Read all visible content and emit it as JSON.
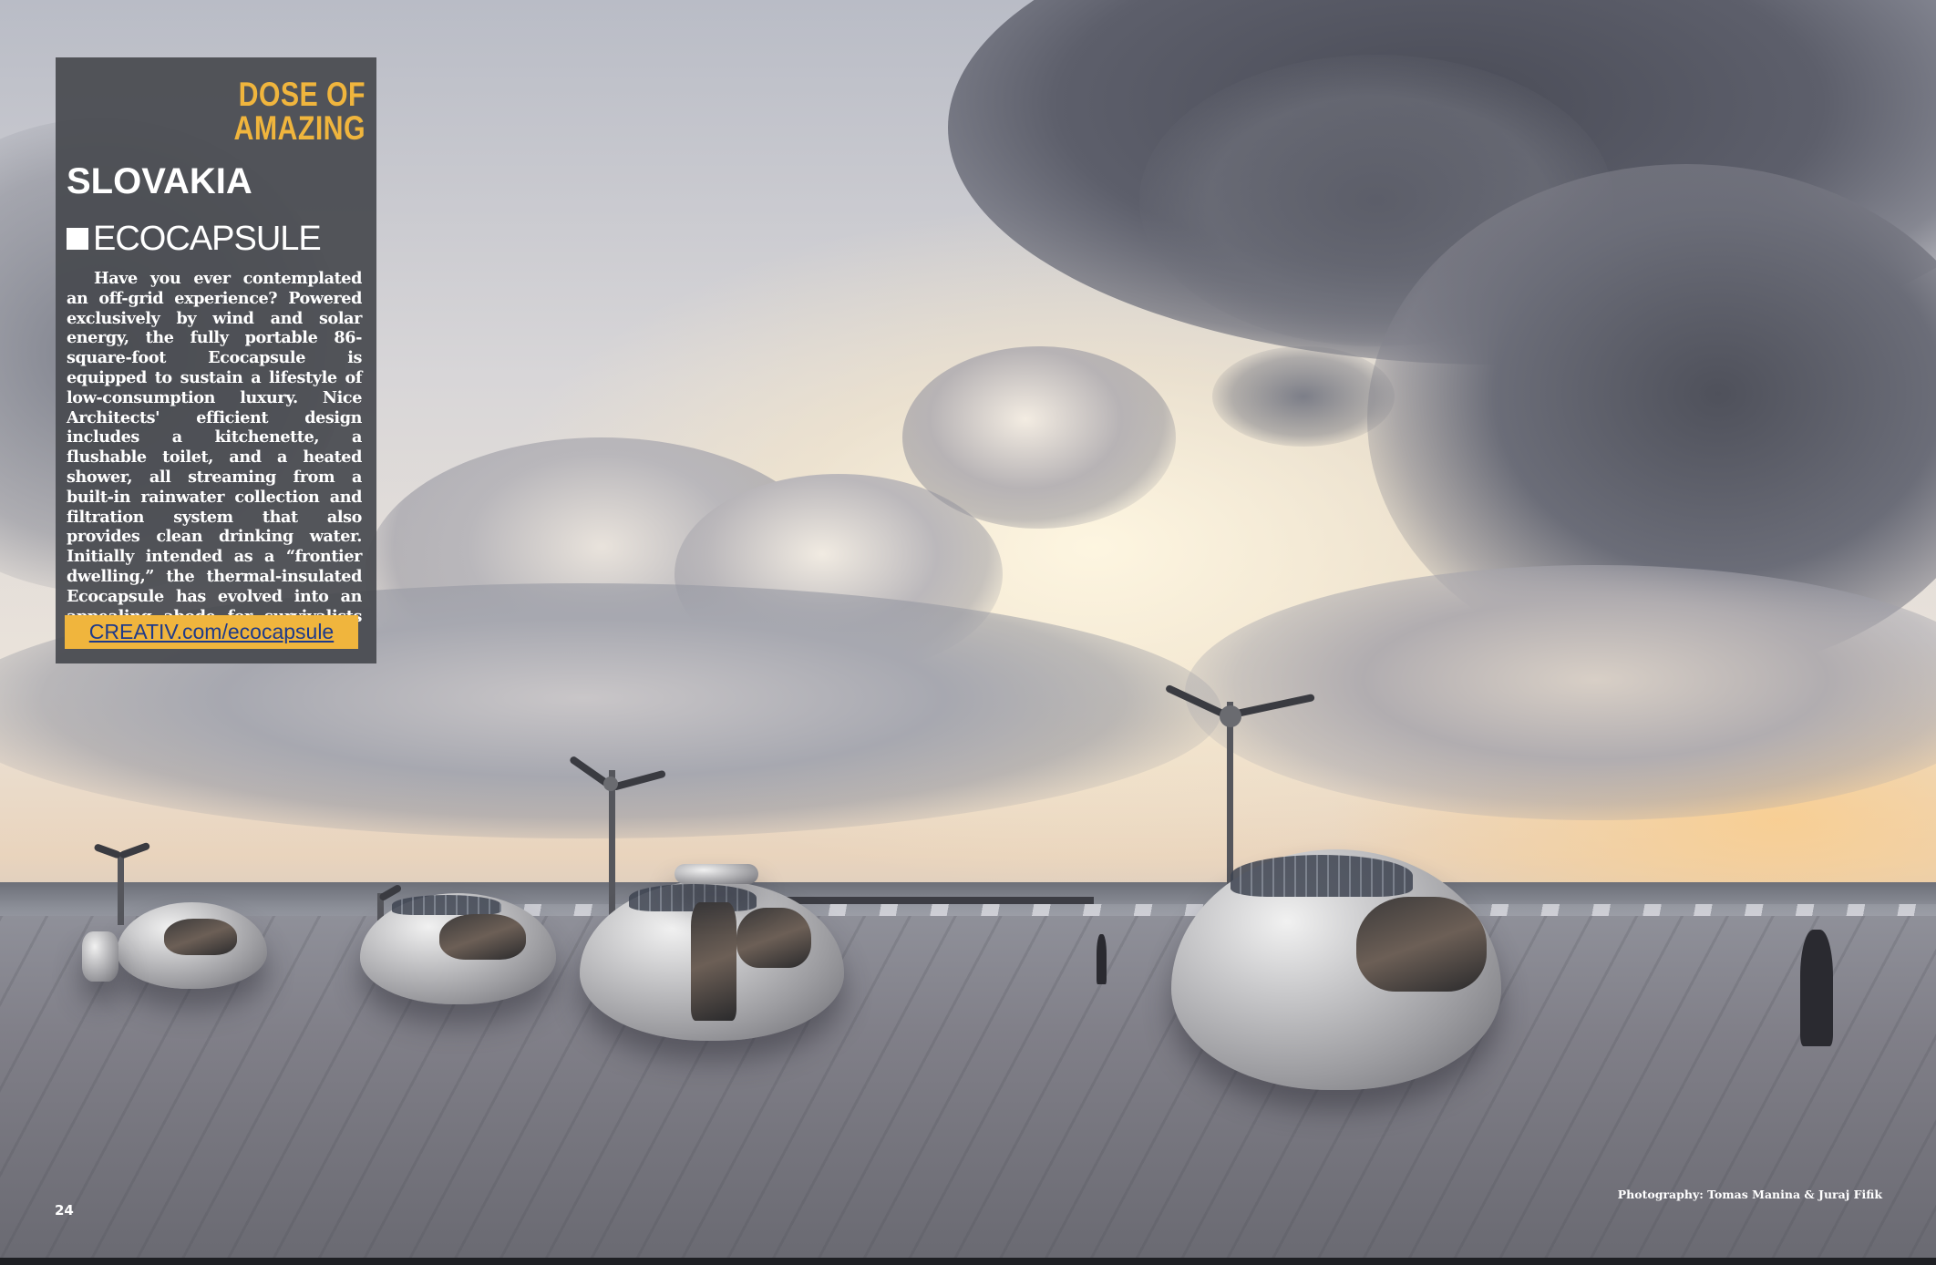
{
  "panel": {
    "kicker": "DOSE OF AMAZING",
    "country": "SLOVAKIA",
    "title": "ECOCAPSULE",
    "body": "Have you ever contemplated an off-grid experience? Powered exclusively by wind and solar energy, the fully portable 86-square-foot Ecocapsule is equipped to sustain a lifestyle of low-consumption luxury. Nice Architects' efficient design includes a kitchenette, a flushable toilet, and a heated shower, all streaming from a built-in rainwater collection and filtration system that also provides clean drinking water. Initially intended as a “frontier dwelling,” the thermal-insulated Ecocapsule has evolved into an appealing abode for survivalists and urbanists alike.",
    "link": "CREATIV.com/ecocapsule"
  },
  "footer": {
    "page_number": "24",
    "photo_credit": "Photography: Tomas Manina & Juraj Fifik"
  },
  "colors": {
    "accent": "#f0b53d",
    "panel_bg": "#484a50",
    "link_text": "#1e3a8a"
  },
  "icons": [
    "square-bullet-icon"
  ]
}
